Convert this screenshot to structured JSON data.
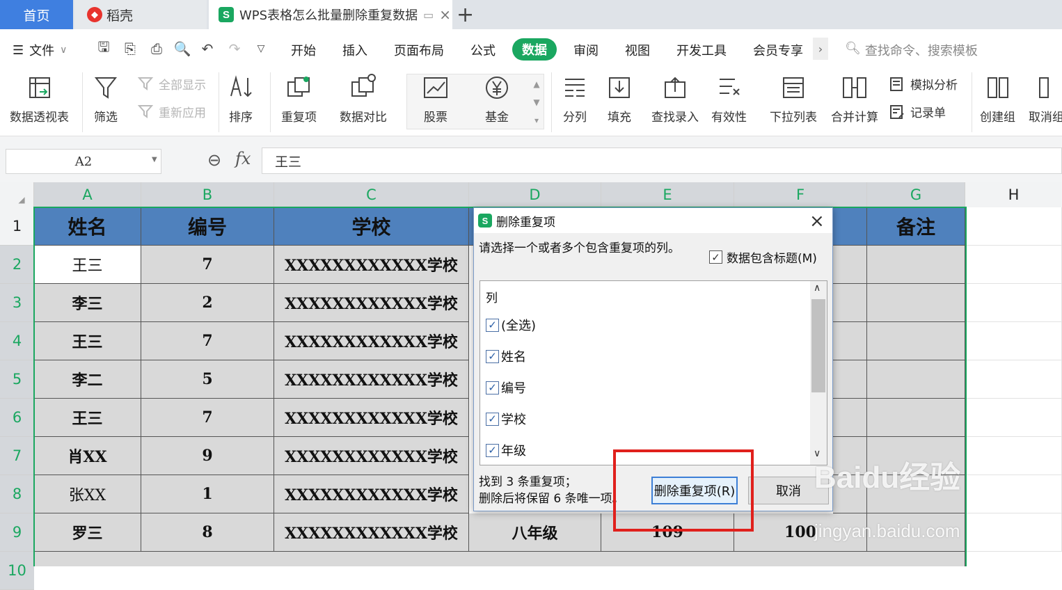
{
  "tabs": {
    "home": "首页",
    "daoke": "稻壳",
    "doc": "WPS表格怎么批量删除重复数据",
    "add": "+"
  },
  "menu": {
    "file": "文件",
    "items": [
      "开始",
      "插入",
      "页面布局",
      "公式",
      "数据",
      "审阅",
      "视图",
      "开发工具",
      "会员专享"
    ],
    "active": "数据",
    "search_placeholder": "查找命令、搜索模板"
  },
  "ribbon": {
    "pivot": "数据透视表",
    "filter": "筛选",
    "show_all": "全部显示",
    "reapply": "重新应用",
    "sort": "排序",
    "duplicates": "重复项",
    "compare": "数据对比",
    "stocks": "股票",
    "funds": "基金",
    "split": "分列",
    "fill": "填充",
    "lookup_entry": "查找录入",
    "validity": "有效性",
    "dropdown": "下拉列表",
    "consolidate": "合并计算",
    "whatif": "模拟分析",
    "record_form": "记录单",
    "group": "创建组",
    "ungroup": "取消组"
  },
  "formula_bar": {
    "name_box": "A2",
    "fx": "fx",
    "value": "王三"
  },
  "columns": [
    "A",
    "B",
    "C",
    "D",
    "E",
    "F",
    "G",
    "H"
  ],
  "rows": [
    "1",
    "2",
    "3",
    "4",
    "5",
    "6",
    "7",
    "8",
    "9",
    "10"
  ],
  "table": {
    "headers": {
      "a": "姓名",
      "b": "编号",
      "c": "学校",
      "g": "备注"
    },
    "rows": [
      {
        "name": "王三",
        "id": "7",
        "school": "XXXXXXXXXXXX学校"
      },
      {
        "name": "李三",
        "id": "2",
        "school": "XXXXXXXXXXXX学校"
      },
      {
        "name": "王三",
        "id": "7",
        "school": "XXXXXXXXXXXX学校"
      },
      {
        "name": "李二",
        "id": "5",
        "school": "XXXXXXXXXXXX学校"
      },
      {
        "name": "王三",
        "id": "7",
        "school": "XXXXXXXXXXXX学校"
      },
      {
        "name": "肖XX",
        "id": "9",
        "school": "XXXXXXXXXXXX学校"
      },
      {
        "name": "张XX",
        "id": "1",
        "school": "XXXXXXXXXXXX学校"
      },
      {
        "name": "罗三",
        "id": "8",
        "school": "XXXXXXXXXXXX学校",
        "grade": "八年级",
        "e": "109",
        "f": "100"
      }
    ]
  },
  "dialog": {
    "title": "删除重复项",
    "prompt": "请选择一个或者多个包含重复项的列。",
    "has_header": "数据包含标题(M)",
    "list_header": "列",
    "options": [
      "(全选)",
      "姓名",
      "编号",
      "学校",
      "年级"
    ],
    "result_line1": "找到 3 条重复项；",
    "result_line2": "删除后将保留 6 条唯一项。",
    "delete_button": "删除重复项(R)",
    "cancel_button": "取消"
  },
  "watermark": {
    "brand": "Baidu经验",
    "url": "jingyan.baidu.com"
  },
  "colors": {
    "accent": "#1aa760",
    "header_fill": "#4f81bd",
    "highlight": "#e0201c"
  }
}
